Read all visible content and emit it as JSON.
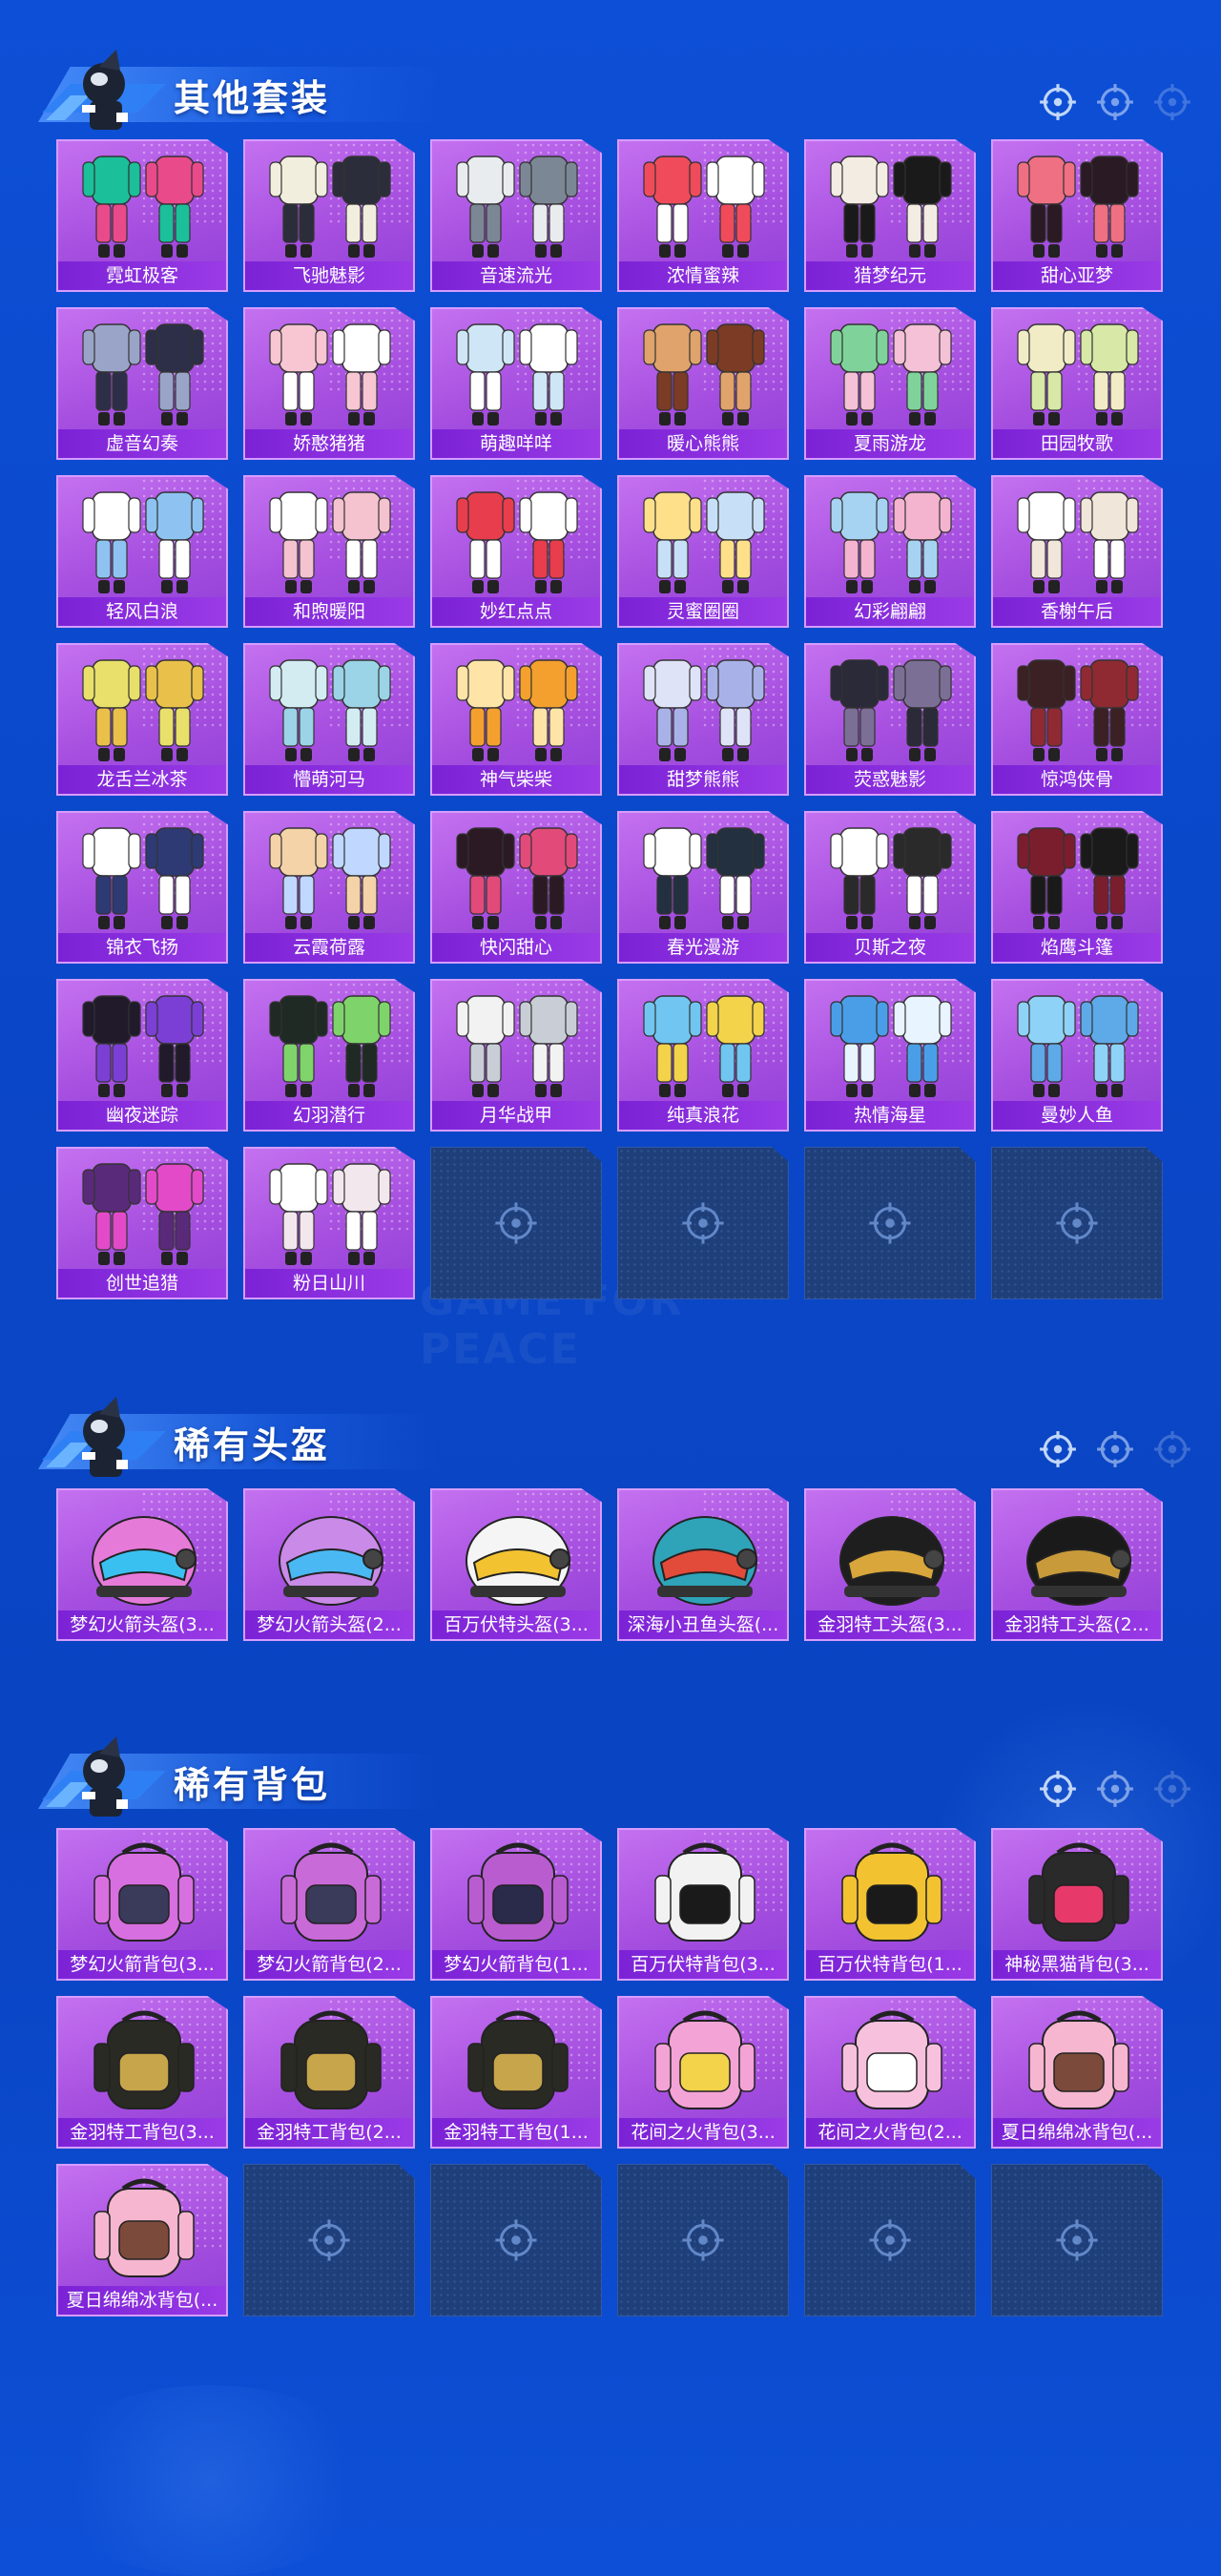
{
  "sections": [
    {
      "title": "其他套装",
      "type": "outfit",
      "items": [
        "霓虹极客",
        "飞驰魅影",
        "音速流光",
        "浓情蜜辣",
        "猎梦纪元",
        "甜心亚梦",
        "虚音幻奏",
        "娇憨猪猪",
        "萌趣咩咩",
        "暖心熊熊",
        "夏雨游龙",
        "田园牧歌",
        "轻风白浪",
        "和煦暖阳",
        "妙红点点",
        "灵蜜圈圈",
        "幻彩翩翩",
        "香榭午后",
        "龙舌兰冰茶",
        "懵萌河马",
        "神气柴柴",
        "甜梦熊熊",
        "荧惑魅影",
        "惊鸿侠骨",
        "锦衣飞扬",
        "云霞荷露",
        "快闪甜心",
        "春光漫游",
        "贝斯之夜",
        "焰鹰斗篷",
        "幽夜迷踪",
        "幻羽潜行",
        "月华战甲",
        "纯真浪花",
        "热情海星",
        "曼妙人鱼",
        "创世追猎",
        "粉日山川"
      ],
      "empty_slots": 4
    },
    {
      "title": "稀有头盔",
      "type": "helmet",
      "items": [
        "梦幻火箭头盔(3...",
        "梦幻火箭头盔(2...",
        "百万伏特头盔(3...",
        "深海小丑鱼头盔(...",
        "金羽特工头盔(3...",
        "金羽特工头盔(2..."
      ],
      "empty_slots": 0
    },
    {
      "title": "稀有背包",
      "type": "backpack",
      "items": [
        "梦幻火箭背包(3...",
        "梦幻火箭背包(2...",
        "梦幻火箭背包(1...",
        "百万伏特背包(3...",
        "百万伏特背包(1...",
        "神秘黑猫背包(3...",
        "金羽特工背包(3...",
        "金羽特工背包(2...",
        "金羽特工背包(1...",
        "花间之火背包(3...",
        "花间之火背包(2...",
        "夏日绵绵冰背包(...",
        "夏日绵绵冰背包(..."
      ],
      "empty_slots": 5
    }
  ],
  "watermark": "GAME FOR PEACE",
  "colors": {
    "card": "#a64fe0",
    "label": "#7b22d6",
    "background": "#0d4fd6",
    "empty": "#1f3f7a"
  }
}
